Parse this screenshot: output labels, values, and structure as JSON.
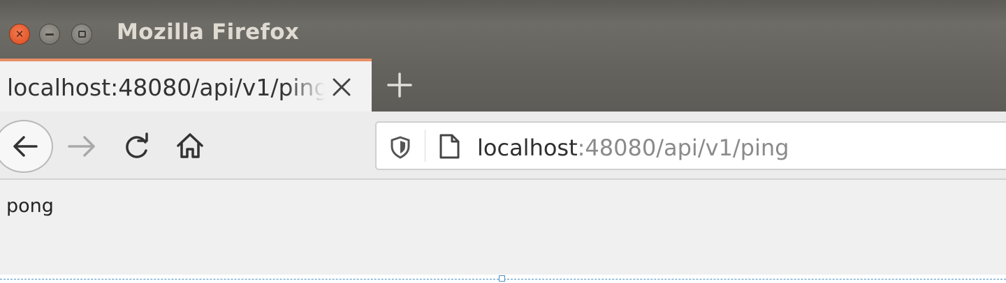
{
  "window": {
    "title": "Mozilla Firefox",
    "controls": [
      "close-icon",
      "minimize-icon",
      "maximize-icon"
    ]
  },
  "tabs": [
    {
      "label": "localhost:48080/api/v1/ping",
      "active": true
    }
  ],
  "new_tab_icon": "plus-icon",
  "toolbar": {
    "back_icon": "arrow-left-icon",
    "forward_icon": "arrow-right-icon",
    "reload_icon": "reload-icon",
    "home_icon": "home-icon"
  },
  "url": {
    "host": "localhost",
    "rest": ":48080/api/v1/ping"
  },
  "page": {
    "body": "pong"
  },
  "colors": {
    "titlebar": "#67655f",
    "tab_accent": "#e88f67",
    "close_button": "#e0572a"
  }
}
